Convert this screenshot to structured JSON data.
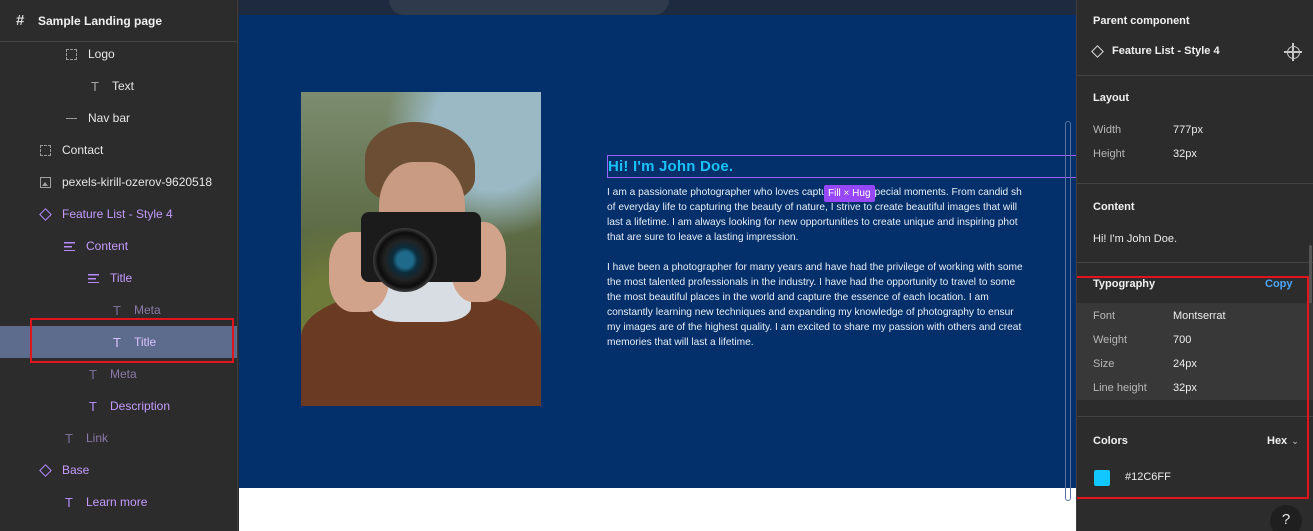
{
  "layers": {
    "page_title": "Sample Landing page",
    "items": [
      {
        "label": "Logo",
        "icon": "frame-dotted-icon"
      },
      {
        "label": "Text",
        "icon": "text-icon"
      },
      {
        "label": "Nav bar",
        "icon": "line-icon"
      },
      {
        "label": "Contact",
        "icon": "frame-dotted-icon"
      },
      {
        "label": "pexels-kirill-ozerov-9620518",
        "icon": "image-icon"
      },
      {
        "label": "Feature List - Style 4",
        "icon": "component-instance-icon"
      },
      {
        "label": "Content",
        "icon": "auto-layout-icon"
      },
      {
        "label": "Title",
        "icon": "auto-layout-icon"
      },
      {
        "label": "Meta",
        "icon": "text-icon"
      },
      {
        "label": "Title",
        "icon": "text-icon"
      },
      {
        "label": "Meta",
        "icon": "text-icon"
      },
      {
        "label": "Description",
        "icon": "text-icon"
      },
      {
        "label": "Link",
        "icon": "text-icon"
      },
      {
        "label": "Base",
        "icon": "component-instance-icon"
      },
      {
        "label": "Learn more",
        "icon": "text-icon"
      }
    ]
  },
  "canvas": {
    "title": "Hi! I'm John Doe.",
    "fill_hug_badge": "Fill × Hug",
    "description_lines": [
      "I am a passionate photographer who loves capturing life's special moments. From candid sh",
      "of everyday life to capturing the beauty of nature, I strive to create beautiful images that will",
      "last a lifetime. I am always looking for new opportunities to create unique and inspiring phot",
      "that are sure to leave a lasting impression.",
      "",
      "I have been a photographer for many years and have had the privilege of working with some",
      "the most talented professionals in the industry. I have had the opportunity to travel to some",
      "the most beautiful places in the world and capture the essence of each location. I am",
      "constantly learning new techniques and expanding my knowledge of photography to ensur",
      "my images are of the highest quality. I am excited to share my passion with others and creat",
      "memories that will last a lifetime."
    ]
  },
  "properties": {
    "parent_component_heading": "Parent component",
    "parent_component_name": "Feature List - Style 4",
    "layout_heading": "Layout",
    "width_label": "Width",
    "width_value": "777px",
    "height_label": "Height",
    "height_value": "32px",
    "content_heading": "Content",
    "content_value": "Hi! I'm John Doe.",
    "typography_heading": "Typography",
    "copy_label": "Copy",
    "font_label": "Font",
    "font_value": "Montserrat",
    "weight_label": "Weight",
    "weight_value": "700",
    "size_label": "Size",
    "size_value": "24px",
    "line_height_label": "Line height",
    "line_height_value": "32px",
    "colors_heading": "Colors",
    "color_format": "Hex",
    "color_value": "#12C6FF",
    "help_label": "?"
  },
  "colors": {
    "accent_purple": "#9747FF",
    "hero_background": "#03306B",
    "title_color": "#12C6FF",
    "highlight_red": "#E0141D"
  }
}
